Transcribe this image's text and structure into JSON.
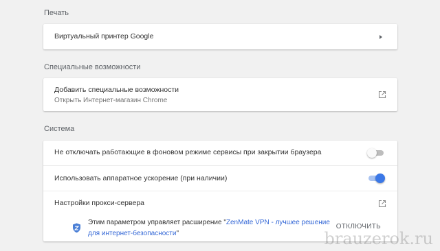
{
  "sections": {
    "print": {
      "title": "Печать",
      "items": [
        {
          "label": "Виртуальный принтер Google"
        }
      ]
    },
    "accessibility": {
      "title": "Специальные возможности",
      "items": [
        {
          "label": "Добавить специальные возможности",
          "sublabel": "Открыть Интернет-магазин Chrome"
        }
      ]
    },
    "system": {
      "title": "Система",
      "background_apps": {
        "label": "Не отключать работающие в фоновом режиме сервисы при закрытии браузера",
        "enabled": false
      },
      "hardware_accel": {
        "label": "Использовать аппаратное ускорение (при наличии)",
        "enabled": true
      },
      "proxy": {
        "label": "Настройки прокси-сервера"
      },
      "proxy_policy": {
        "text_before": "Этим параметром управляет расширение \"",
        "extension_name_line1": "ZenMate VPN - лучшее решение",
        "extension_name_line2": "для интернет-безопасности",
        "text_after": "\"",
        "disable_label": "ОТКЛЮЧИТЬ"
      }
    }
  },
  "colors": {
    "accent": "#3b78e7",
    "shield": "#4a7fd6"
  },
  "icons": {
    "submenu": "arrow-right-icon",
    "external": "external-link-icon",
    "extension": "shield-icon"
  },
  "watermark": "brauzerok.ru"
}
